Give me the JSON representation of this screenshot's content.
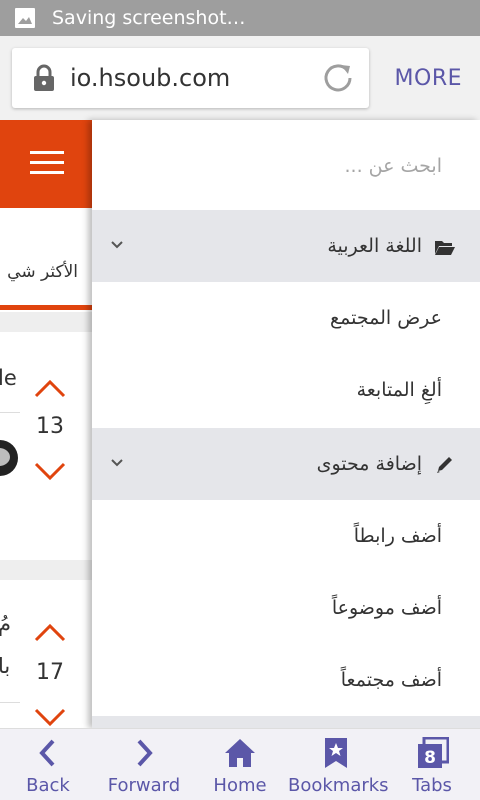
{
  "status_bar": {
    "text": "Saving screenshot…",
    "icon": "image-icon"
  },
  "browser": {
    "url": "io.hsoub.com",
    "more_label": "MORE",
    "accent_color": "#5b57a8"
  },
  "page": {
    "header_color": "#e0440e",
    "tab_label": "الأكثر شي",
    "posts": [
      {
        "snippet": "le",
        "votes": "13"
      },
      {
        "snippet": "مُ",
        "snippet2": "با",
        "votes": "17"
      }
    ]
  },
  "drawer": {
    "search_placeholder": "ابحث عن ...",
    "sections": [
      {
        "title": "اللغة العربية",
        "icon": "folder-open-icon",
        "items": [
          "عرض المجتمع",
          "ألغِ المتابعة"
        ]
      },
      {
        "title": "إضافة محتوى",
        "icon": "pencil-icon",
        "items": [
          "أضف رابطاً",
          "أضف موضوعاً",
          "أضف مجتمعاً"
        ]
      }
    ]
  },
  "bottom_nav": {
    "items": [
      {
        "label": "Back",
        "icon": "back-arrow-icon"
      },
      {
        "label": "Forward",
        "icon": "forward-arrow-icon"
      },
      {
        "label": "Home",
        "icon": "home-icon"
      },
      {
        "label": "Bookmarks",
        "icon": "bookmark-icon"
      },
      {
        "label": "Tabs",
        "icon": "tabs-icon",
        "count": "8"
      }
    ]
  }
}
